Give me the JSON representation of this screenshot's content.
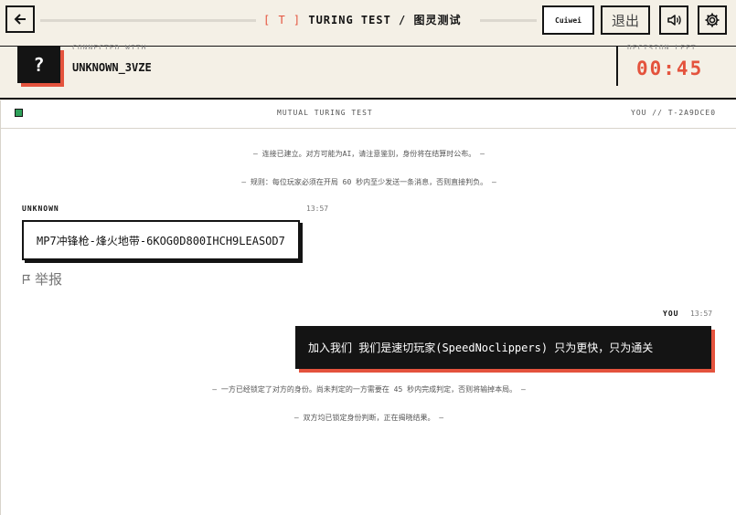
{
  "header": {
    "title_bracket": "[ T ]",
    "title": "TURING TEST / 图灵测试",
    "user_name": "Cuiwei",
    "exit_label": "退出"
  },
  "opponent": {
    "connected_label": "CONNECTED WITH",
    "avatar_glyph": "?",
    "name": "UNKNOWN_3VZE"
  },
  "decision": {
    "label": "DECISION LEFT",
    "timer": "00:45"
  },
  "chat": {
    "mode": "MUTUAL TURING TEST",
    "session": "YOU // T-2A9DCE0",
    "system_messages": [
      "— 连接已建立。对方可能为AI，请注意鉴别，身份将在结算时公布。 —",
      "— 规则：每位玩家必须在开局 60 秒内至少发送一条消息，否则直接判负。 —",
      "— 一方已经锁定了对方的身份。尚未判定的一方需要在 45 秒内完成判定，否则将输掉本局。 —",
      "— 双方均已锁定身份判断，正在揭晓结果。 —"
    ],
    "incoming": {
      "sender": "UNKNOWN",
      "time": "13:57",
      "text": "MP7冲锋枪-烽火地带-6KOG0D800IHCH9LEASOD7",
      "report_label": "举报"
    },
    "outgoing": {
      "sender": "YOU",
      "time": "13:57",
      "text": "加入我们 我们是速切玩家(SpeedNoclippers) 只为更快，只为通关"
    }
  },
  "colors": {
    "accent": "#e4533d",
    "ink": "#141414",
    "paper": "#f4f0e6",
    "online": "#2fa15a"
  },
  "icons": {
    "back": "arrow-left-icon",
    "sound": "speaker-icon",
    "settings": "gear-icon",
    "report": "flag-icon"
  }
}
